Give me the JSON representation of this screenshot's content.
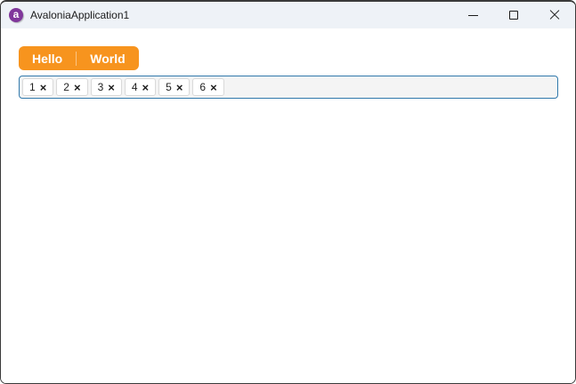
{
  "titlebar": {
    "app_title": "AvaloniaApplication1",
    "logo_letter": "a"
  },
  "window_controls": {
    "minimize": "minimize-icon",
    "maximize": "maximize-icon",
    "close": "close-icon"
  },
  "tabs": [
    {
      "label": "Hello",
      "selected": true
    },
    {
      "label": "World",
      "selected": false
    }
  ],
  "chips": {
    "close_glyph": "×",
    "items": [
      {
        "label": "1"
      },
      {
        "label": "2"
      },
      {
        "label": "3"
      },
      {
        "label": "4"
      },
      {
        "label": "5"
      },
      {
        "label": "6"
      }
    ]
  },
  "colors": {
    "titlebar_bg": "#eef2f7",
    "tab_accent_orange": "#f7941e",
    "chiplist_border_blue": "#3078ab",
    "chiplist_bg": "#f4f4f4",
    "logo_purple": "#80379b",
    "window_border": "#3a3a3a"
  }
}
